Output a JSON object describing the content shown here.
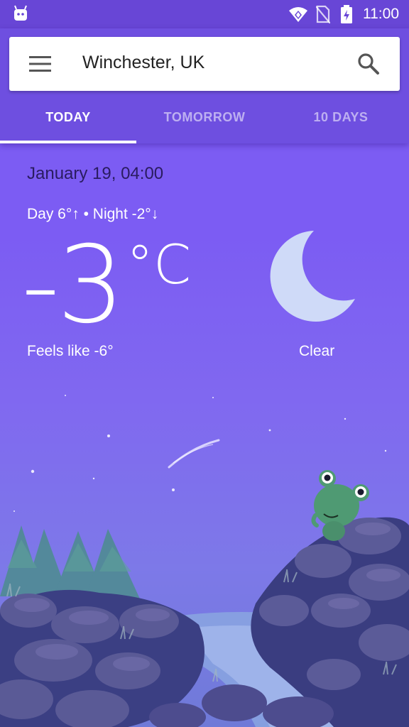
{
  "status": {
    "time": "11:00"
  },
  "search": {
    "location": "Winchester, UK"
  },
  "tabs": [
    {
      "label": "TODAY",
      "active": true
    },
    {
      "label": "TOMORROW",
      "active": false
    },
    {
      "label": "10 DAYS",
      "active": false
    }
  ],
  "weather": {
    "datetime": "January 19, 04:00",
    "day_night": "Day 6°↑ • Night -2°↓",
    "temperature": "-3",
    "unit": "°C",
    "feels_like": "Feels like -6°",
    "condition": "Clear",
    "condition_icon": "moon-icon"
  },
  "colors": {
    "status_bar": "#6846d6",
    "app_bar": "#6e4fe0",
    "sky": "#7c5cf3"
  }
}
